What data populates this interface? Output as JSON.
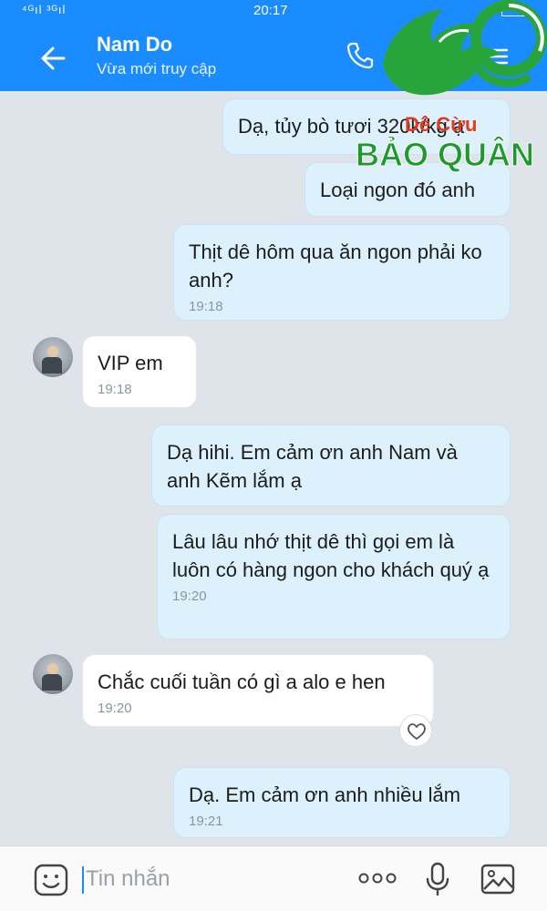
{
  "status": {
    "signal": "⁴ᴳıl ³ᴳıl",
    "time": "20:17"
  },
  "header": {
    "title": "Nam Do",
    "subtitle": "Vừa mới truy cập"
  },
  "logo": {
    "top_text": "Dê Cừu",
    "bottom_text": "BẢO QUÂN",
    "color": "#1e9a2c",
    "accent": "#e23b1e"
  },
  "messages": [
    {
      "side": "out",
      "text": "Dạ,  tủy bò tươi 320k/kg ạ",
      "time": ""
    },
    {
      "side": "out",
      "text": "Loại ngon đó anh",
      "time": ""
    },
    {
      "side": "out",
      "text": "Thịt dê hôm qua ăn ngon phải ko anh?",
      "time": "19:18"
    },
    {
      "side": "in",
      "text": "VIP em",
      "time": "19:18"
    },
    {
      "side": "out",
      "text": "Dạ hihi.  Em cảm ơn anh Nam và anh Kẽm lắm ạ",
      "time": ""
    },
    {
      "side": "out",
      "text": "Lâu lâu nhớ thịt dê thì gọi em là luôn có hàng ngon cho khách quý ạ",
      "time": "19:20"
    },
    {
      "side": "in",
      "text": "Chắc cuối tuần có gì a alo e hen",
      "time": "19:20"
    },
    {
      "side": "out",
      "text": "Dạ.  Em cảm ơn anh nhiều lắm",
      "time": "19:21"
    }
  ],
  "input": {
    "placeholder": "Tin nhắn"
  },
  "colors": {
    "header": "#1a8cff",
    "out_bubble": "#dcf1fc",
    "in_bubble": "#ffffff",
    "background": "#dfe4ea"
  }
}
